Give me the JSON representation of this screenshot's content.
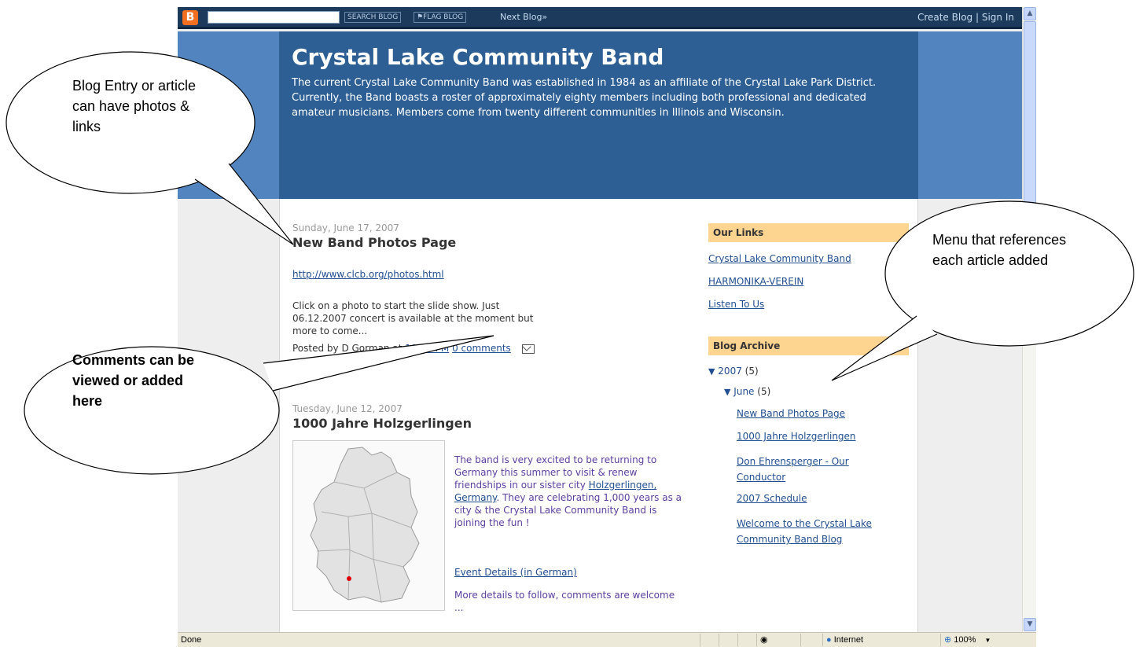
{
  "navbar": {
    "search_button": "SEARCH BLOG",
    "flag_button": "FLAG BLOG",
    "next_blog": "Next Blog»",
    "create_blog": "Create Blog",
    "separator": "|",
    "sign_in": "Sign In"
  },
  "blog": {
    "title": "Crystal Lake Community Band",
    "description": "The current Crystal Lake Community Band was established in 1984 as an affiliate of the Crystal Lake Park District. Currently, the Band boasts a roster of approximately eighty members including both professional and dedicated amateur musicians. Members come from twenty different communities in Illinois and Wisconsin."
  },
  "posts": [
    {
      "date": "Sunday, June 17, 2007",
      "title": "New Band Photos Page",
      "url": "http://www.clcb.org/photos.html",
      "body": "Click on a photo to start the slide show. Just 06.12.2007 concert is available at the moment but more to come...",
      "footer_prefix": "Posted by D Gorman at",
      "time": "10:24 PM",
      "comments": "0 comments"
    },
    {
      "date": "Tuesday, June 12, 2007",
      "title": "1000 Jahre Holzgerlingen",
      "body_before_link": "The band is very excited to be returning to Germany this summer to visit & renew friendships in our sister city",
      "body_link": "Holzgerlingen, Germany",
      "body_after_link": ". They are celebrating 1,000 years as a city & the Crystal Lake Community Band is joining the fun !",
      "event_link": "Event Details (in German)",
      "more": "More details to follow, comments are welcome ..."
    }
  ],
  "sidebar": {
    "links_heading": "Our Links",
    "links": [
      "Crystal Lake Community Band",
      "HARMONIKA-VEREIN",
      "Listen To Us"
    ],
    "archive_heading": "Blog Archive",
    "archive_year": "2007",
    "archive_year_count": "(5)",
    "archive_month": "June",
    "archive_month_count": "(5)",
    "archive_posts": [
      "New Band Photos Page",
      "1000 Jahre Holzgerlingen",
      "Don Ehrensperger - Our Conductor",
      "2007 Schedule",
      "Welcome to the Crystal Lake Community Band Blog"
    ]
  },
  "statusbar": {
    "status": "Done",
    "zone": "Internet",
    "zoom": "100%"
  },
  "callouts": {
    "entry": "Blog Entry or article can have photos & links",
    "comments": "Comments can be viewed or added here",
    "menu": "Menu that references each article added"
  },
  "colors": {
    "navbar": "#1c3a5c",
    "header": "#2d5f95",
    "header_band": "#5285c0",
    "sidebar_heading": "#fed491",
    "link": "#224f91"
  }
}
